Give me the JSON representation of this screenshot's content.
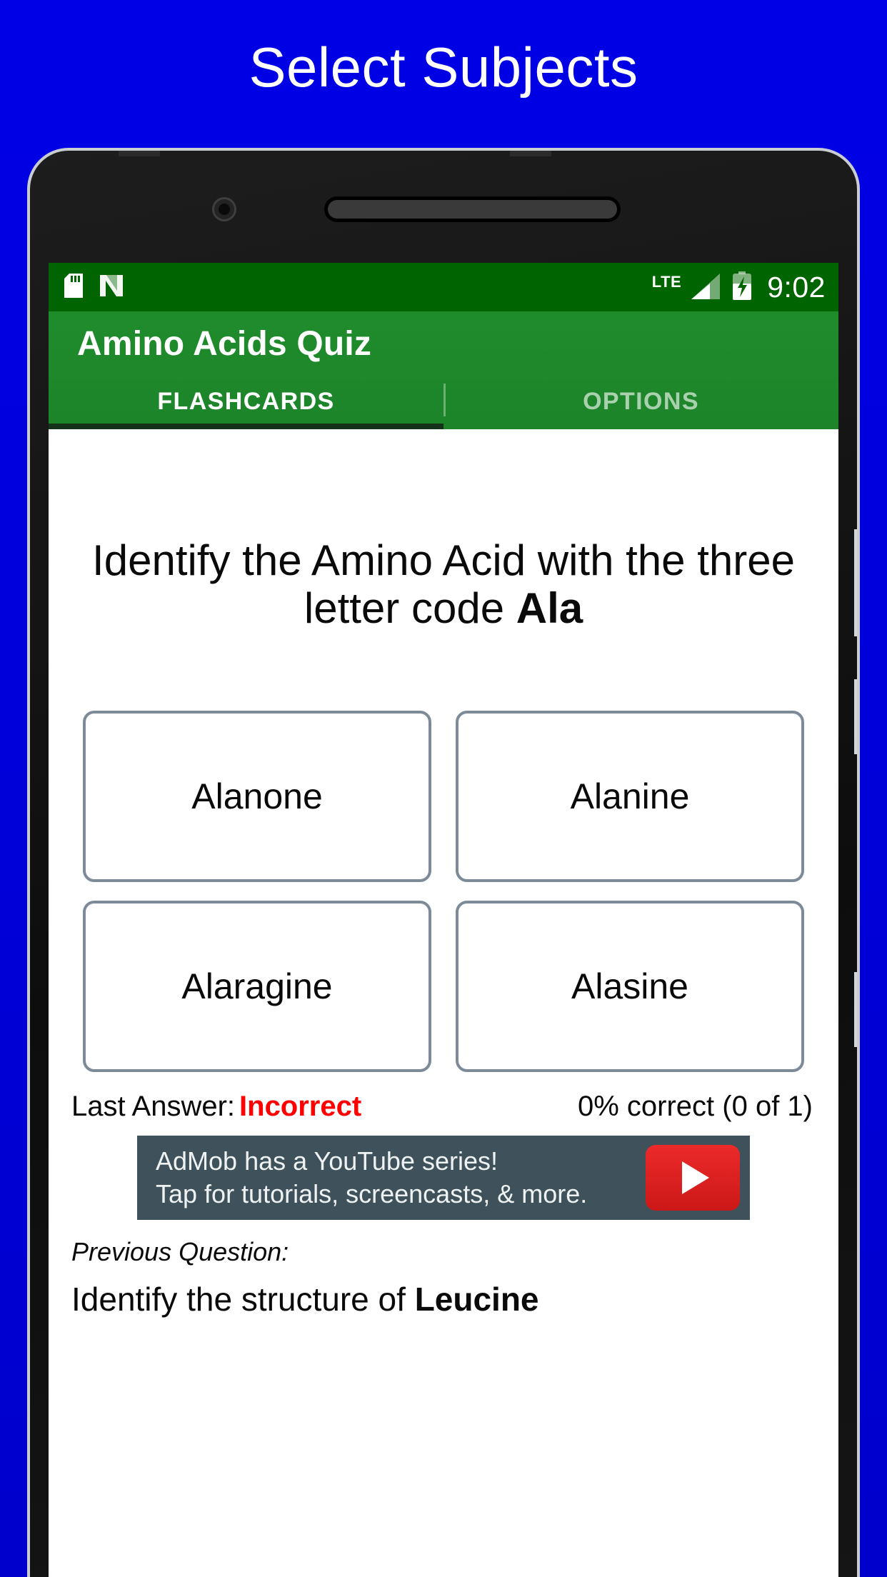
{
  "promo": {
    "title": "Select Subjects",
    "background_color": "#0000D8",
    "text_color": "#FFFFFF"
  },
  "status_bar": {
    "icons": [
      "sdcard-icon",
      "nfc-icon"
    ],
    "network_label": "LTE",
    "battery_state": "charging",
    "time": "9:02",
    "background_color": "#006400"
  },
  "app_bar": {
    "title": "Amino Acids Quiz",
    "background_color": "#1F8C2C",
    "tabs": [
      {
        "label": "FLASHCARDS",
        "active": true
      },
      {
        "label": "OPTIONS",
        "active": false
      }
    ]
  },
  "quiz": {
    "question_prefix": "Identify the Amino Acid with the three letter code ",
    "question_code": "Ala",
    "answers": [
      {
        "label": "Alanone"
      },
      {
        "label": "Alanine"
      },
      {
        "label": "Alaragine"
      },
      {
        "label": "Alasine"
      }
    ],
    "last_answer_label": "Last Answer:",
    "last_answer_value": "Incorrect",
    "last_answer_color": "#FF0000",
    "score": "0% correct (0 of 1)"
  },
  "ad": {
    "line1": "AdMob has a YouTube series!",
    "line2": "Tap for tutorials, screencasts, & more.",
    "badge": "youtube-play-icon",
    "background_color": "#3F525B",
    "badge_color": "#E02020"
  },
  "previous": {
    "label": "Previous Question:",
    "text_prefix": "Identify the structure of ",
    "text_bold": "Leucine"
  }
}
